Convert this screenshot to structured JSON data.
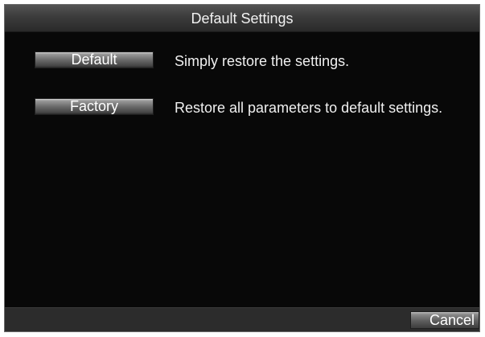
{
  "window": {
    "title": "Default Settings"
  },
  "options": {
    "default_button": "Default",
    "default_description": "Simply restore the settings.",
    "factory_button": "Factory",
    "factory_description": "Restore all parameters to default settings."
  },
  "footer": {
    "cancel_button": "Cancel"
  }
}
